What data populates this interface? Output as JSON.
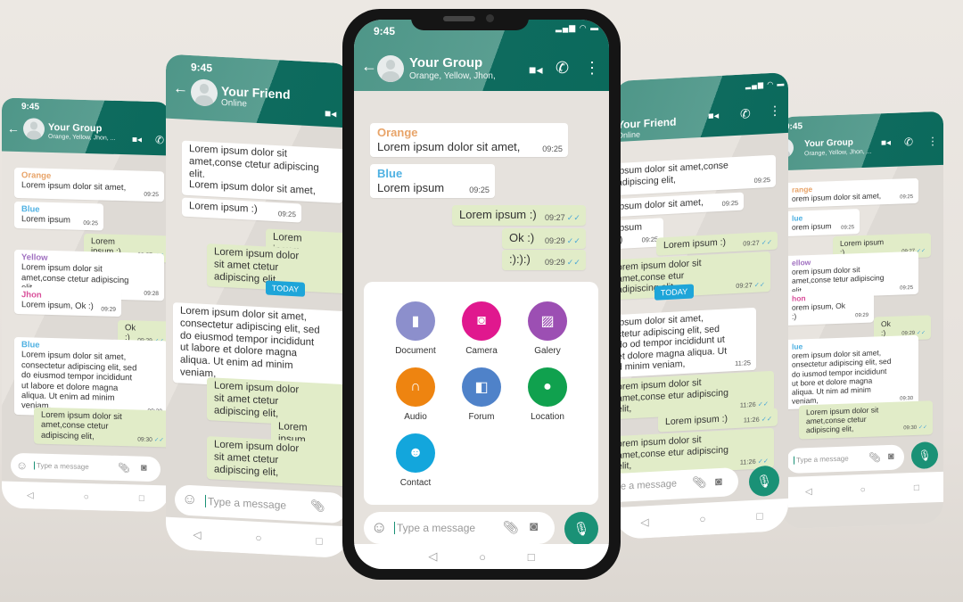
{
  "status_time": "9:45",
  "main_phone": {
    "header": {
      "title": "Your Group",
      "subtitle": "Orange, Yellow, Jhon,"
    },
    "messages": [
      {
        "dir": "in",
        "sender": "Orange",
        "sender_color": "#e8a469",
        "text": "Lorem ipsum dolor sit amet,",
        "time": "09:25"
      },
      {
        "dir": "in",
        "sender": "Blue",
        "sender_color": "#4fb1e2",
        "text": "Lorem ipsum",
        "time": "09:25"
      },
      {
        "dir": "out",
        "text": "Lorem ipsum :)",
        "time": "09:27"
      },
      {
        "dir": "out",
        "text": "Ok :)",
        "time": "09:29"
      },
      {
        "dir": "out",
        "text": ":):):)",
        "time": "09:29"
      }
    ],
    "attachments": [
      {
        "label": "Document",
        "icon": "document-icon",
        "color": "#8c8fcc"
      },
      {
        "label": "Camera",
        "icon": "camera-icon",
        "color": "#e0188e"
      },
      {
        "label": "Galery",
        "icon": "gallery-icon",
        "color": "#9c4fb3"
      },
      {
        "label": "Audio",
        "icon": "headphones-icon",
        "color": "#ee8410"
      },
      {
        "label": "Forum",
        "icon": "forum-icon",
        "color": "#4f82c9"
      },
      {
        "label": "Location",
        "icon": "location-pin-icon",
        "color": "#10a14e"
      },
      {
        "label": "Contact",
        "icon": "contact-icon",
        "color": "#13a6dc"
      }
    ],
    "input_placeholder": "Type a message"
  },
  "friend_phone_left": {
    "header": {
      "title": "Your Friend",
      "subtitle": "Online"
    },
    "messages": [
      {
        "dir": "in",
        "text": "Lorem ipsum dolor sit amet,conse ctetur adipiscing elit,",
        "time": ""
      },
      {
        "dir": "in",
        "text": "Lorem ipsum dolor sit amet,",
        "time": ""
      },
      {
        "dir": "in",
        "text": "Lorem ipsum :)",
        "time": "09:25"
      },
      {
        "dir": "out",
        "text": "Lorem ipsum :)",
        "time": ""
      },
      {
        "dir": "out",
        "text": "Lorem ipsum dolor sit amet ctetur adipiscing elit,",
        "time": ""
      },
      {
        "dir": "in",
        "text": "Lorem ipsum dolor sit amet, consectetur adipiscing elit, sed do eiusmod tempor incididunt ut labore et dolore magna aliqua. Ut enim ad minim veniam,",
        "time": ""
      },
      {
        "dir": "out",
        "text": "Lorem ipsum dolor sit amet ctetur adipiscing elit,",
        "time": ""
      },
      {
        "dir": "out",
        "text": "Lorem ipsum :)",
        "time": ""
      },
      {
        "dir": "out",
        "text": "Lorem ipsum dolor sit amet ctetur adipiscing elit,",
        "time": ""
      }
    ],
    "today_label": "TODAY",
    "input_placeholder": "Type a message"
  },
  "group_phone_left": {
    "header": {
      "title": "Your Group",
      "subtitle": "Orange, Yellow, Jhon, ..."
    },
    "messages": [
      {
        "dir": "in",
        "sender": "Orange",
        "sender_color": "#e8a469",
        "text": "Lorem ipsum dolor sit amet,",
        "time": "09:25"
      },
      {
        "dir": "in",
        "sender": "Blue",
        "sender_color": "#4fb1e2",
        "text": "Lorem ipsum",
        "time": "09:25"
      },
      {
        "dir": "out",
        "text": "Lorem ipsum :)",
        "time": "09:27"
      },
      {
        "dir": "in",
        "sender": "Yellow",
        "sender_color": "#a070c0",
        "text": "Lorem ipsum dolor sit amet,conse ctetur adipiscing elit,",
        "time": "09:28"
      },
      {
        "dir": "in",
        "sender": "Jhon",
        "sender_color": "#d94f9a",
        "text": "Lorem ipsum, Ok :)",
        "time": "09:29"
      },
      {
        "dir": "out",
        "text": "Ok :)",
        "time": "09:29"
      },
      {
        "dir": "in",
        "sender": "Blue",
        "sender_color": "#4fb1e2",
        "text": "Lorem ipsum dolor sit amet, consectetur adipiscing elit, sed do eiusmod tempor incididunt ut labore et dolore magna aliqua. Ut enim ad minim veniam,",
        "time": "09:30"
      },
      {
        "dir": "out",
        "text": "Lorem ipsum dolor sit amet,conse ctetur adipiscing elit,",
        "time": "09:30"
      }
    ],
    "input_placeholder": "Type a message"
  },
  "friend_phone_right": {
    "header": {
      "title": "Your Friend",
      "subtitle": "Online"
    },
    "messages": [
      {
        "dir": "in",
        "text": "ipsum dolor sit amet,conse adipiscing elit,",
        "time": "09:25"
      },
      {
        "dir": "in",
        "text": "ipsum dolor sit amet,",
        "time": "09:25"
      },
      {
        "dir": "in",
        "text": "ipsum :)",
        "time": "09:25"
      },
      {
        "dir": "out",
        "text": "Lorem ipsum :)",
        "time": "09:27"
      },
      {
        "dir": "out",
        "text": "orem ipsum dolor sit amet,conse etur adipiscing elit,",
        "time": "09:27"
      },
      {
        "dir": "in",
        "text": "ipsum dolor sit amet, ctetur adipiscing elit, sed do od tempor incididunt ut et dolore magna aliqua. Ut d minim veniam,",
        "time": "11:25"
      },
      {
        "dir": "out",
        "text": "orem ipsum dolor sit amet,conse etur adipiscing elit,",
        "time": "11:26"
      },
      {
        "dir": "out",
        "text": "Lorem ipsum :)",
        "time": "11:26"
      },
      {
        "dir": "out",
        "text": "orem ipsum dolor sit amet,conse etur adipiscing elit,",
        "time": "11:26"
      }
    ],
    "today_label": "TODAY",
    "input_placeholder": "e a message"
  },
  "group_phone_right": {
    "header": {
      "title": "Your Group",
      "subtitle": "Orange, Yellow, Jhon, ..."
    },
    "messages": [
      {
        "dir": "in",
        "sender": "range",
        "sender_color": "#e8a469",
        "text": "orem ipsum dolor sit amet,",
        "time": "09:25"
      },
      {
        "dir": "in",
        "sender": "lue",
        "sender_color": "#4fb1e2",
        "text": "orem ipsum",
        "time": "09:25"
      },
      {
        "dir": "out",
        "text": "Lorem ipsum :)",
        "time": "09:27"
      },
      {
        "dir": "in",
        "sender": "ellow",
        "sender_color": "#a070c0",
        "text": "orem ipsum dolor sit amet,conse tetur adipiscing elit,",
        "time": "09:25"
      },
      {
        "dir": "in",
        "sender": "hon",
        "sender_color": "#d94f9a",
        "text": "orem ipsum, Ok :)",
        "time": "09:29"
      },
      {
        "dir": "out",
        "text": "Ok :)",
        "time": "09:29"
      },
      {
        "dir": "in",
        "sender": "lue",
        "sender_color": "#4fb1e2",
        "text": "orem ipsum dolor sit amet, onsectetur adipiscing elit, sed do iusmod tempor incididunt ut bore et dolore magna aliqua. Ut nim ad minim veniam,",
        "time": "09:30"
      },
      {
        "dir": "out",
        "text": "Lorem ipsum dolor sit amet,conse ctetur adipiscing elit,",
        "time": "09:30"
      }
    ],
    "input_placeholder": "Type a message"
  }
}
